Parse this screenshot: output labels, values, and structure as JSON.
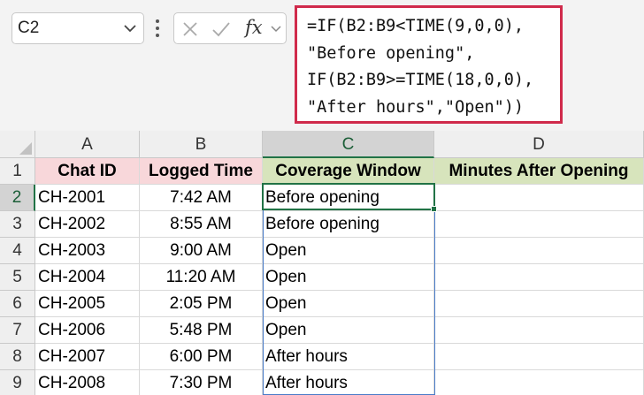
{
  "name_box": {
    "value": "C2"
  },
  "formula_bar": {
    "fx_label": "fx",
    "formula_lines": [
      "=IF(B2:B9<TIME(9,0,0),",
      "\"Before opening\",",
      "IF(B2:B9>=TIME(18,0,0),",
      "\"After hours\",\"Open\"))"
    ],
    "highlight_color": "#d02a4b"
  },
  "sheet": {
    "columns": [
      "A",
      "B",
      "C",
      "D"
    ],
    "selected_column": "C",
    "selected_row": "2",
    "rows": [
      "1",
      "2",
      "3",
      "4",
      "5",
      "6",
      "7",
      "8",
      "9"
    ],
    "headers": [
      "Chat ID",
      "Logged Time",
      "Coverage Window",
      "Minutes After Opening"
    ],
    "header_colors": [
      "#f8d7da",
      "#f8d7da",
      "#d7e4bc",
      "#d7e4bc"
    ],
    "data": [
      [
        "CH-2001",
        "7:42 AM",
        "Before opening",
        ""
      ],
      [
        "CH-2002",
        "8:55 AM",
        "Before opening",
        ""
      ],
      [
        "CH-2003",
        "9:00 AM",
        "Open",
        ""
      ],
      [
        "CH-2004",
        "11:20 AM",
        "Open",
        ""
      ],
      [
        "CH-2005",
        "2:05 PM",
        "Open",
        ""
      ],
      [
        "CH-2006",
        "5:48 PM",
        "Open",
        ""
      ],
      [
        "CH-2007",
        "6:00 PM",
        "After hours",
        ""
      ],
      [
        "CH-2008",
        "7:30 PM",
        "After hours",
        ""
      ]
    ]
  }
}
